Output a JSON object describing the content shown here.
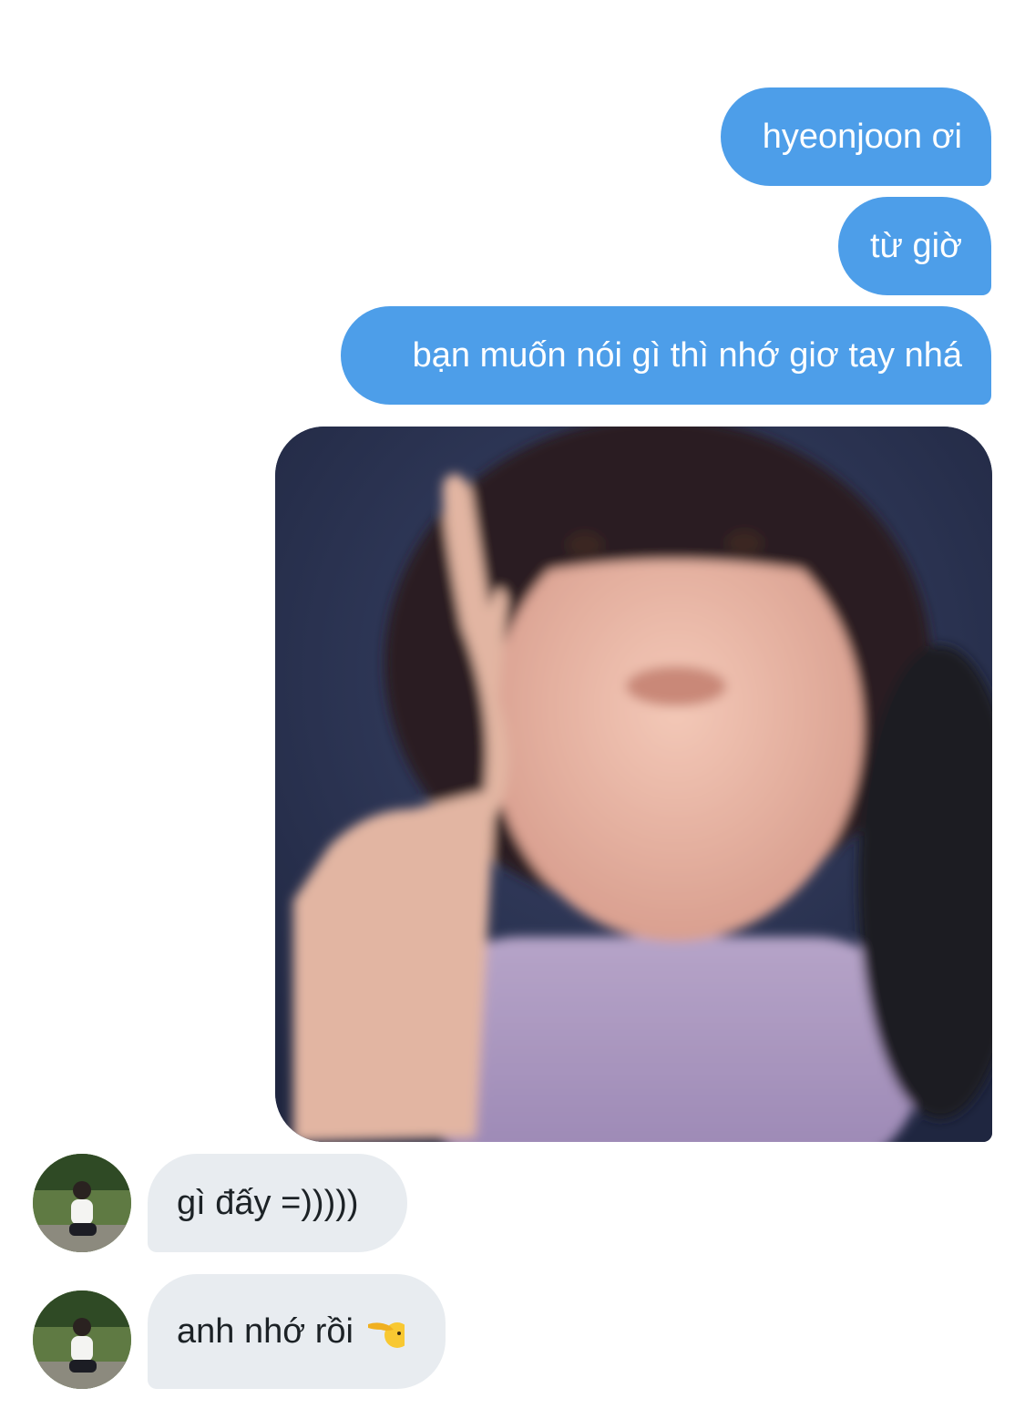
{
  "messages": {
    "outgoing": [
      {
        "text": "hyeonjoon ơi"
      },
      {
        "text": "từ giờ"
      },
      {
        "text": "bạn muốn nói gì thì nhớ giơ tay nhá"
      }
    ],
    "incoming": [
      {
        "text": "gì đấy =)))))"
      },
      {
        "text": "anh nhớ rồi"
      }
    ]
  },
  "colors": {
    "outgoing_bubble": "#4d9ee9",
    "incoming_bubble": "#e8ecf0",
    "background": "#ffffff"
  },
  "icons": {
    "salute_emoji": "saluting-face-icon"
  }
}
